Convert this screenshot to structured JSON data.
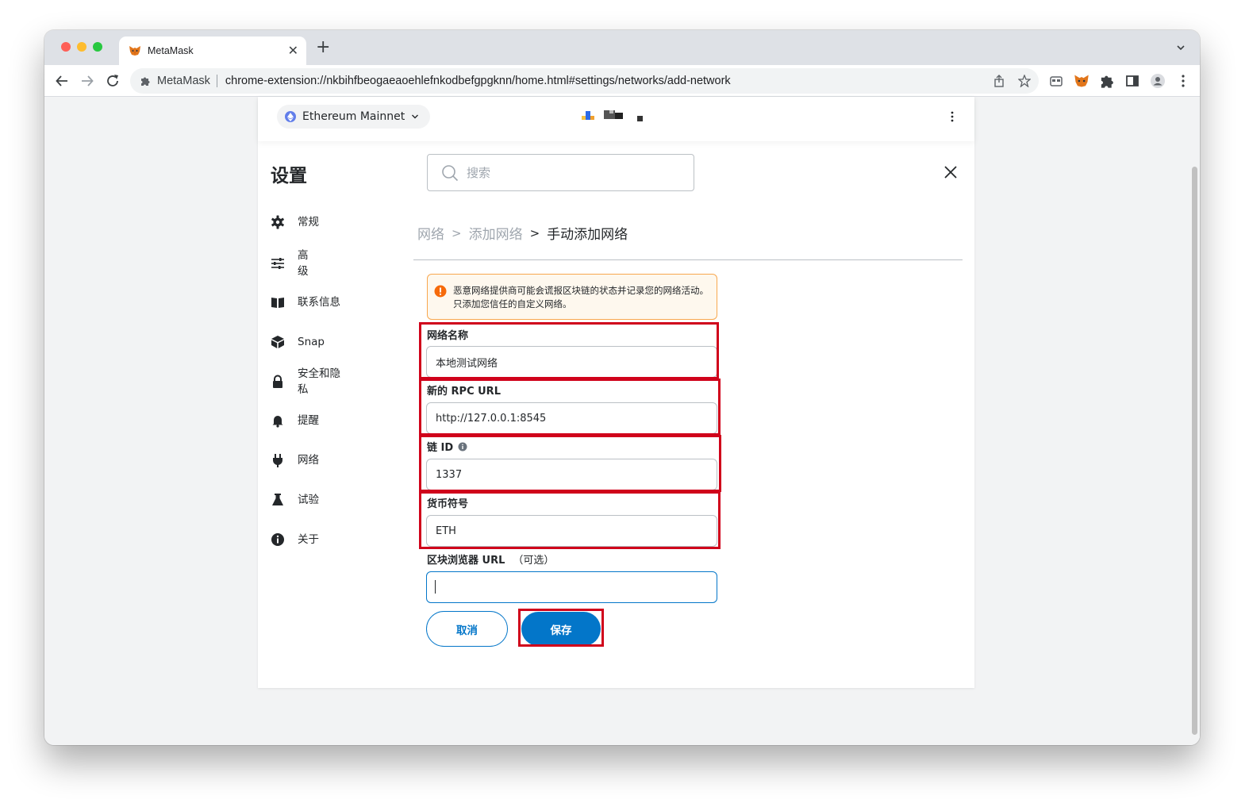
{
  "browser": {
    "tab_title": "MetaMask",
    "omnibox_label": "MetaMask",
    "url": "chrome-extension://nkbihfbeogaeaoehlefnkodbefgpgknn/home.html#settings/networks/add-network"
  },
  "header": {
    "network_name": "Ethereum Mainnet"
  },
  "settings": {
    "title": "设置",
    "search_placeholder": "搜索"
  },
  "sidebar": {
    "items": [
      {
        "label": "常规",
        "icon": "gear-icon"
      },
      {
        "label": "高级",
        "icon": "sliders-icon"
      },
      {
        "label": "联系信息",
        "icon": "book-icon"
      },
      {
        "label": "Snap",
        "icon": "cube-icon"
      },
      {
        "label": "安全和隐私",
        "icon": "lock-icon"
      },
      {
        "label": "提醒",
        "icon": "bell-icon"
      },
      {
        "label": "网络",
        "icon": "plug-icon"
      },
      {
        "label": "试验",
        "icon": "flask-icon"
      },
      {
        "label": "关于",
        "icon": "info-icon"
      }
    ]
  },
  "breadcrumb": {
    "level1": "网络",
    "level2": "添加网络",
    "level3": "手动添加网络",
    "separator": ">"
  },
  "warning": {
    "text": "恶意网络提供商可能会谎报区块链的状态并记录您的网络活动。只添加您信任的自定义网络。"
  },
  "form": {
    "network_name": {
      "label": "网络名称",
      "value": "本地测试网络"
    },
    "rpc_url": {
      "label": "新的 RPC URL",
      "value": "http://127.0.0.1:8545"
    },
    "chain_id": {
      "label": "链 ID",
      "value": "1337"
    },
    "currency_symbol": {
      "label": "货币符号",
      "value": "ETH"
    },
    "explorer_url": {
      "label": "区块浏览器 URL",
      "optional": "（可选）",
      "value": ""
    }
  },
  "buttons": {
    "cancel": "取消",
    "save": "保存"
  },
  "colors": {
    "primary": "#0376c9",
    "highlight": "#d0021b",
    "warning_border": "#f8a84f"
  }
}
